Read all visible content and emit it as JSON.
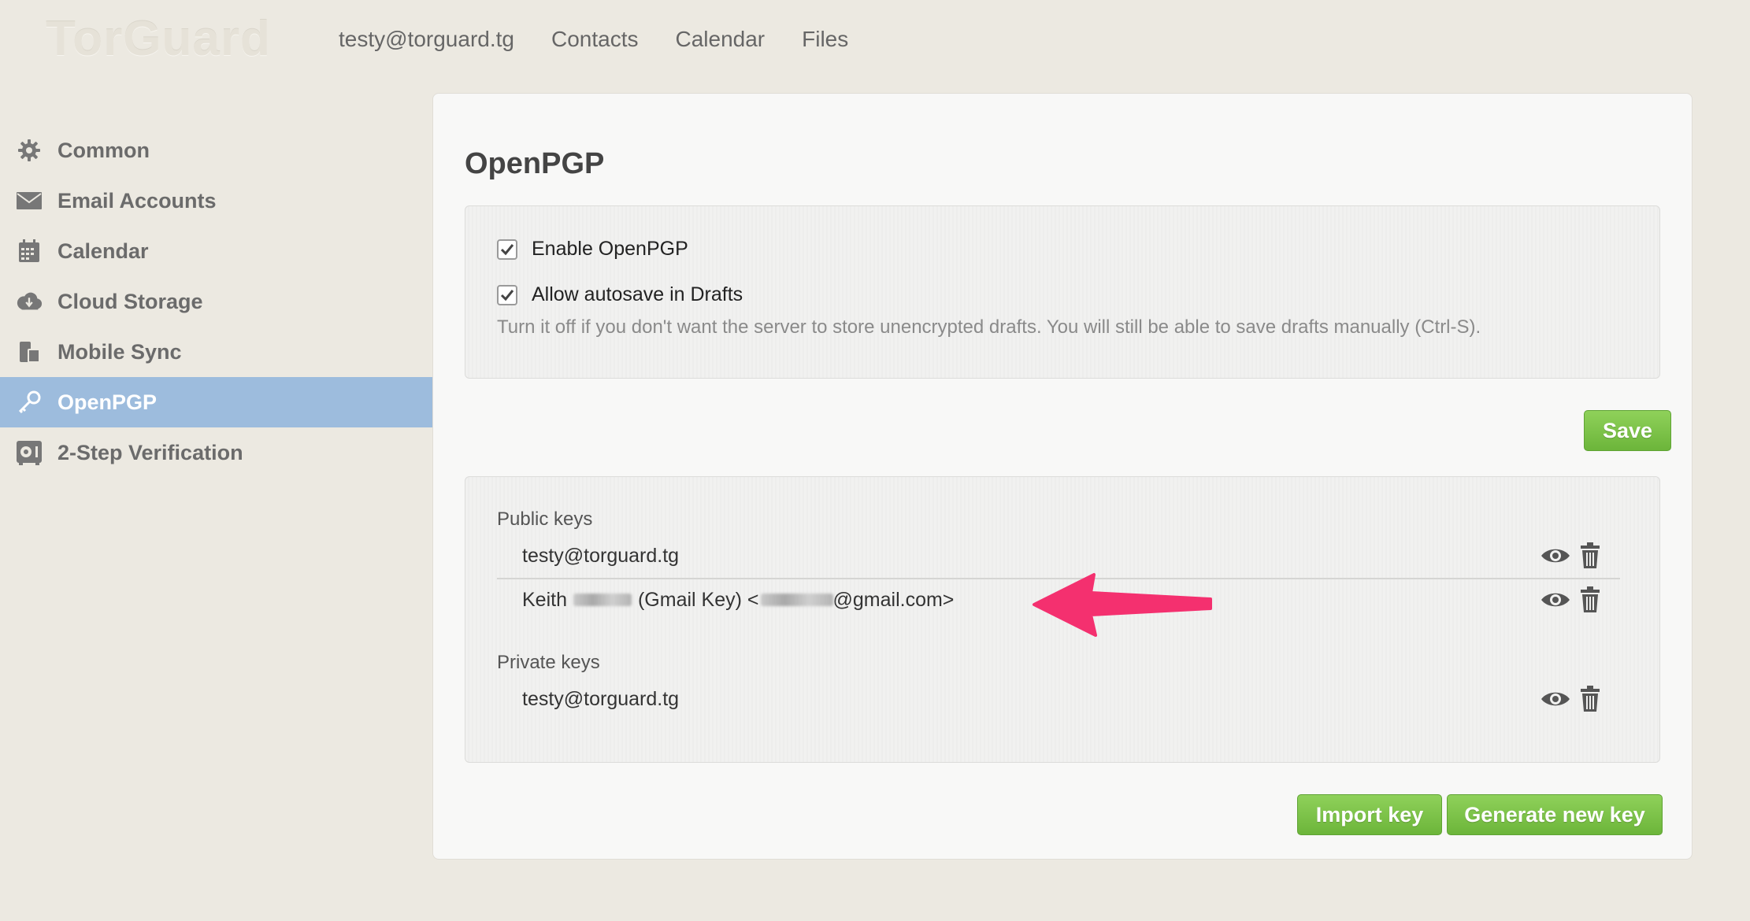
{
  "brand": {
    "logo": "TorGuard"
  },
  "topnav": [
    "testy@torguard.tg",
    "Contacts",
    "Calendar",
    "Files"
  ],
  "sidebar": {
    "items": [
      {
        "label": "Common",
        "icon": "gear-icon"
      },
      {
        "label": "Email Accounts",
        "icon": "envelope-icon"
      },
      {
        "label": "Calendar",
        "icon": "calendar-icon"
      },
      {
        "label": "Cloud Storage",
        "icon": "cloud-download-icon"
      },
      {
        "label": "Mobile Sync",
        "icon": "mobile-sync-icon"
      },
      {
        "label": "OpenPGP",
        "icon": "key-icon",
        "active": true
      },
      {
        "label": "2-Step Verification",
        "icon": "safe-icon"
      }
    ]
  },
  "main": {
    "title": "OpenPGP",
    "settings": {
      "enable_label": "Enable OpenPGP",
      "enable_checked": true,
      "autosave_label": "Allow autosave in Drafts",
      "autosave_checked": true,
      "autosave_hint": "Turn it off if you don't want the server to store unencrypted drafts. You will still be able to save drafts manually (Ctrl-S)."
    },
    "save_label": "Save",
    "keys": {
      "public_label": "Public keys",
      "public": [
        {
          "prefix": "testy@torguard.tg"
        },
        {
          "prefix": "Keith",
          "middle": "(Gmail Key) <",
          "suffix": "@gmail.com>"
        }
      ],
      "private_label": "Private keys",
      "private": [
        {
          "prefix": "testy@torguard.tg"
        }
      ]
    },
    "import_label": "Import key",
    "generate_label": "Generate new key"
  },
  "colors": {
    "accent_green": "#7cc24a",
    "sidebar_active": "#9dbcdd",
    "annotation_arrow": "#f4306f"
  }
}
